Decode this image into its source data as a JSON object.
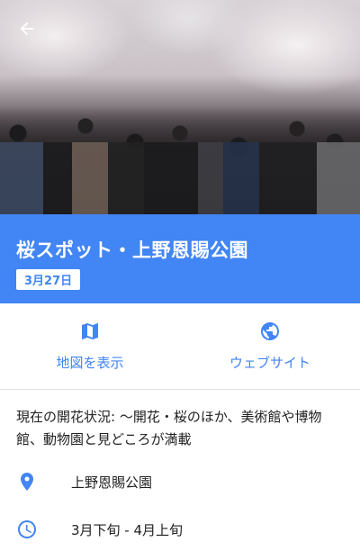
{
  "header": {
    "back_icon": "arrow-back-icon"
  },
  "title": "桜スポット・上野恩賜公園",
  "date_badge": "3月27日",
  "actions": [
    {
      "label": "地図を表示",
      "icon": "map-icon"
    },
    {
      "label": "ウェブサイト",
      "icon": "globe-icon"
    }
  ],
  "description": "現在の開花状況: 〜開花・桜のほか、美術館や博物館、動物園と見どころが満載",
  "location": {
    "icon": "location-pin-icon",
    "text": "上野恩賜公園"
  },
  "period": {
    "icon": "clock-icon",
    "text": "3月下旬 - 4月上旬"
  },
  "colors": {
    "accent": "#4285f4",
    "text": "#212121",
    "divider": "#e0e0e0"
  }
}
